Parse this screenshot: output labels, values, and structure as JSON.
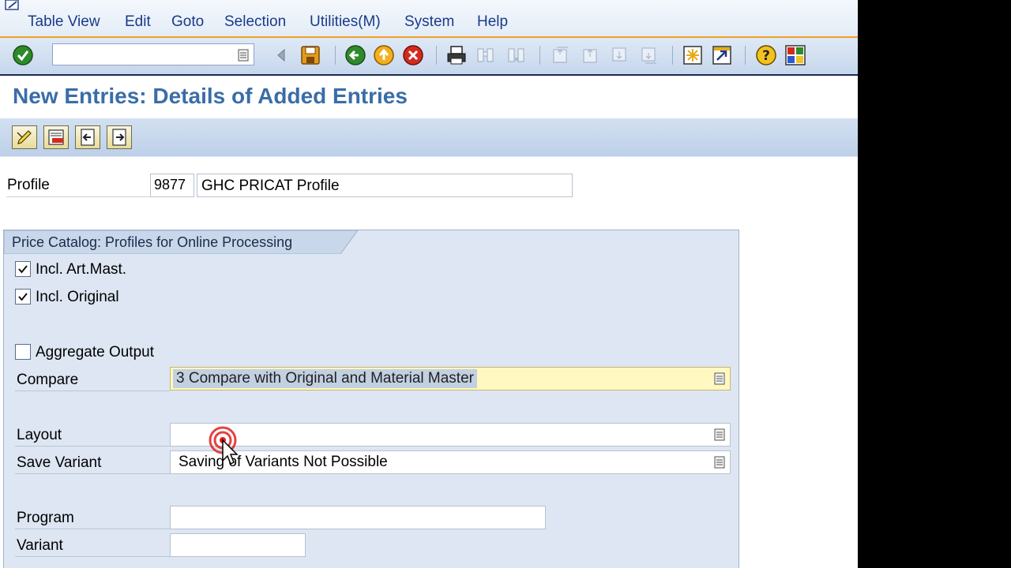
{
  "menu": {
    "items": [
      "Table View",
      "Edit",
      "Goto",
      "Selection",
      "Utilities(M)",
      "System",
      "Help"
    ]
  },
  "toolbar": {
    "command_field_value": "",
    "icons": [
      "enter-icon",
      "back-arrow-icon",
      "save-icon",
      "back-icon",
      "exit-icon",
      "cancel-icon",
      "print-icon",
      "find-icon",
      "find-next-icon",
      "first-page-icon",
      "previous-page-icon",
      "next-page-icon",
      "last-page-icon",
      "new-session-icon",
      "shortcut-icon",
      "help-icon",
      "layout-icon"
    ]
  },
  "title": "New Entries: Details of Added Entries",
  "app_toolbar": {
    "icons": [
      "change-icon",
      "delete-icon",
      "previous-entry-icon",
      "next-entry-icon"
    ]
  },
  "profile": {
    "label": "Profile",
    "id": "9877",
    "description": "GHC PRICAT Profile"
  },
  "group": {
    "title": "Price Catalog: Profiles for Online Processing",
    "incl_art_mast": {
      "label": "Incl. Art.Mast.",
      "checked": true
    },
    "incl_original": {
      "label": "Incl. Original",
      "checked": true
    },
    "aggregate_output": {
      "label": "Aggregate Output",
      "checked": false
    },
    "compare": {
      "label": "Compare",
      "value": "3 Compare with Original and Material Master"
    },
    "layout": {
      "label": "Layout",
      "value": ""
    },
    "save_variant": {
      "label": "Save Variant",
      "value": "Saving of Variants Not Possible"
    },
    "program": {
      "label": "Program",
      "value": ""
    },
    "variant": {
      "label": "Variant",
      "value": ""
    }
  },
  "colors": {
    "menu_text": "#1a3a8a",
    "title_text": "#3a6da8",
    "accent_line": "#f0a020",
    "group_background": "#dde6f2",
    "highlight_field": "#fff8c0"
  }
}
